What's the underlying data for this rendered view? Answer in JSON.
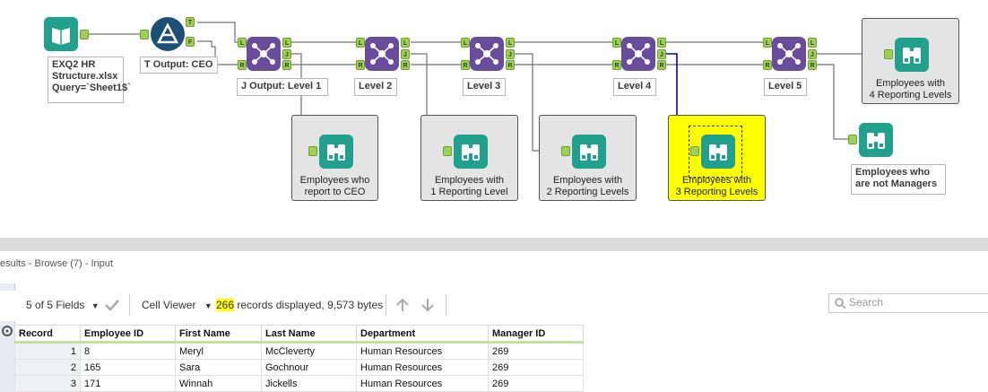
{
  "canvas": {
    "input_tool": {
      "label_lines": [
        "EXQ2 HR",
        "Structure.xlsx",
        "Query=`Sheet1$`"
      ]
    },
    "filter_tool": {
      "label": "T Output: CEO",
      "anchors": [
        "T",
        "F"
      ]
    },
    "join_tools": [
      {
        "label": "J Output: Level 1"
      },
      {
        "label": "Level 2"
      },
      {
        "label": "Level 3"
      },
      {
        "label": "Level 4"
      },
      {
        "label": "Level 5"
      }
    ],
    "join_anchors": {
      "in_left": "L",
      "in_right": "R",
      "out_left": "L",
      "out_join": "J",
      "out_right": "R"
    },
    "browse_containers": [
      {
        "lines": [
          "Employees who",
          "report to CEO"
        ],
        "highlight": false
      },
      {
        "lines": [
          "Employees with",
          "1 Reporting Level"
        ],
        "highlight": false
      },
      {
        "lines": [
          "Employees with",
          "2 Reporting Levels"
        ],
        "highlight": false
      },
      {
        "lines": [
          "Employees with",
          "3 Reporting Levels"
        ],
        "highlight": true
      },
      {
        "lines": [
          "Employees with",
          "4 Reporting Levels"
        ],
        "highlight": false
      }
    ],
    "browse_not_managers": {
      "label_lines": [
        "Employees who",
        "are not Managers"
      ]
    },
    "colors": {
      "input": "#21a08e",
      "filter": "#1c4f73",
      "join": "#6a4c9c",
      "highlight": "#ffff00",
      "selected_wire": "#0000cc"
    }
  },
  "results": {
    "title": "esults - Browse (7) - Input",
    "toolbar": {
      "fields": "5 of 5 Fields",
      "cell_viewer": "Cell Viewer",
      "records_count": "266",
      "records_text": " records displayed, 9,573 bytes",
      "search_placeholder": "Search"
    },
    "columns": [
      "Record",
      "Employee ID",
      "First Name",
      "Last Name",
      "Department",
      "Manager ID"
    ],
    "rows": [
      [
        "1",
        "8",
        "Meryl",
        "McCleverty",
        "Human Resources",
        "269"
      ],
      [
        "2",
        "165",
        "Sara",
        "Gochnour",
        "Human Resources",
        "269"
      ],
      [
        "3",
        "171",
        "Winnah",
        "Jickells",
        "Human Resources",
        "269"
      ]
    ]
  }
}
